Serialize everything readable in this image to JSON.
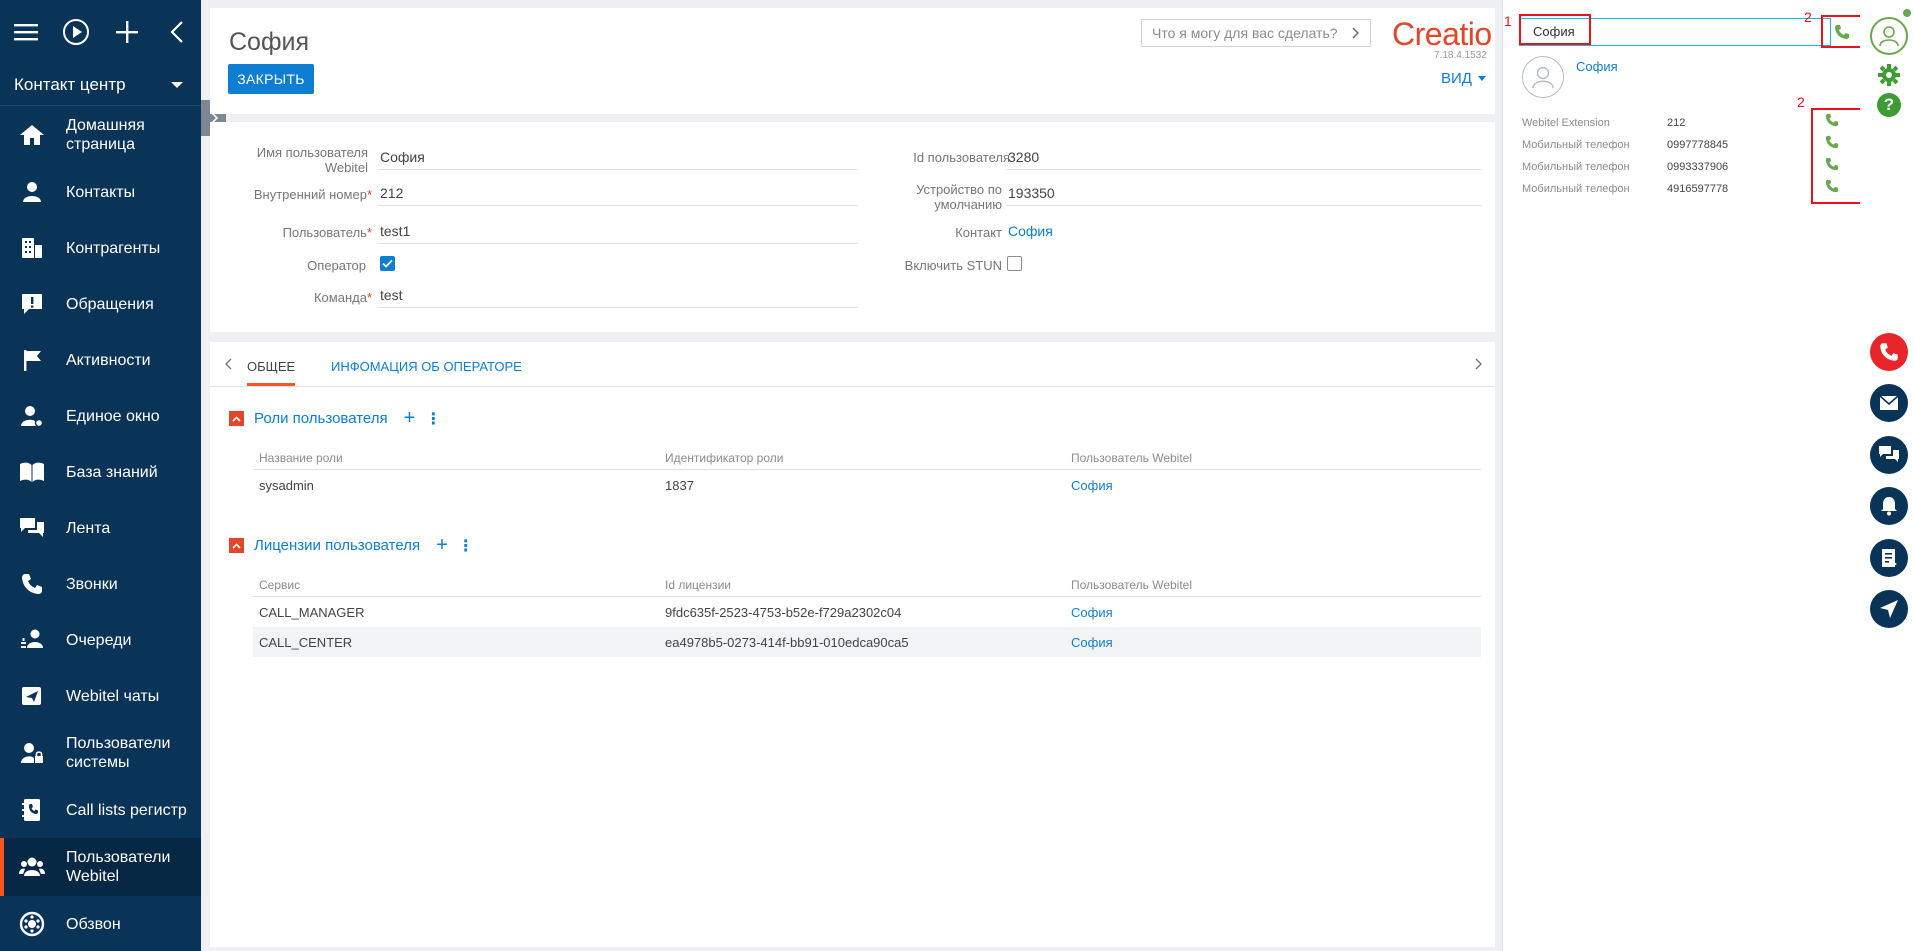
{
  "sidebar": {
    "workplace": "Контакт центр",
    "items": [
      {
        "label": "Домашняя страница",
        "icon": "home-icon"
      },
      {
        "label": "Контакты",
        "icon": "person-icon"
      },
      {
        "label": "Контрагенты",
        "icon": "building-icon"
      },
      {
        "label": "Обращения",
        "icon": "alert-icon"
      },
      {
        "label": "Активности",
        "icon": "flag-icon"
      },
      {
        "label": "Единое окно",
        "icon": "person-gear-icon"
      },
      {
        "label": "База знаний",
        "icon": "book-icon"
      },
      {
        "label": "Лента",
        "icon": "chat-icon"
      },
      {
        "label": "Звонки",
        "icon": "phone-icon"
      },
      {
        "label": "Очереди",
        "icon": "queue-icon"
      },
      {
        "label": "Webitel чаты",
        "icon": "paper-plane-icon"
      },
      {
        "label": "Пользователи системы",
        "icon": "user-lock-icon"
      },
      {
        "label": "Call lists регистр",
        "icon": "address-book-icon"
      },
      {
        "label": "Пользователи Webitel",
        "icon": "users-icon"
      },
      {
        "label": "Обзвон",
        "icon": "dial-icon"
      }
    ]
  },
  "header": {
    "title": "София",
    "close_label": "ЗАКРЫТЬ",
    "search_placeholder": "Что я могу для вас сделать?",
    "logo": "Creatio",
    "version": "7.18.4.1532",
    "view_label": "ВИД"
  },
  "fields": {
    "webitel_user_label": "Имя пользователя Webitel",
    "webitel_user_value": "София",
    "internal_number_label": "Внутренний номер",
    "internal_number_value": "212",
    "user_label": "Пользователь",
    "user_value": "test1",
    "operator_label": "Оператор",
    "operator_checked": true,
    "team_label": "Команда",
    "team_value": "test",
    "user_id_label": "Id пользователя",
    "user_id_value": "3280",
    "device_label": "Устройство по умолчанию",
    "device_value": "193350",
    "contact_label": "Контакт",
    "contact_value": "София",
    "stun_label": "Включить STUN",
    "stun_checked": false
  },
  "tabs": {
    "general": "ОБЩЕЕ",
    "operator_info": "ИНФОМАЦИЯ ОБ ОПЕРАТОРЕ"
  },
  "roles": {
    "title": "Роли пользователя",
    "columns": [
      "Название роли",
      "Идентификатор роли",
      "Пользователь Webitel"
    ],
    "rows": [
      [
        "sysadmin",
        "1837",
        "София"
      ]
    ]
  },
  "licenses": {
    "title": "Лицензии пользователя",
    "columns": [
      "Сервис",
      "Id лицензии",
      "Пользователь Webitel"
    ],
    "rows": [
      [
        "CALL_MANAGER",
        "9fdc635f-2523-4753-b52e-f729a2302c04",
        "София"
      ],
      [
        "CALL_CENTER",
        "ea4978b5-0273-414f-bb91-010edca90ca5",
        "София"
      ]
    ]
  },
  "cti": {
    "search_value": "София",
    "marker_1": "1",
    "marker_2": "2",
    "contact_name": "София",
    "contacts": [
      {
        "type": "Webitel Extension",
        "value": "212"
      },
      {
        "type": "Мобильный телефон",
        "value": "0997778845"
      },
      {
        "type": "Мобильный телефон",
        "value": "0993337906"
      },
      {
        "type": "Мобильный телефон",
        "value": "4916597778"
      }
    ]
  },
  "colors": {
    "sidebar": "#0a3358",
    "accent": "#0d7ed1",
    "brand": "#e2462b",
    "call_green": "#6aa84f",
    "annotation_red": "#e8131d"
  }
}
